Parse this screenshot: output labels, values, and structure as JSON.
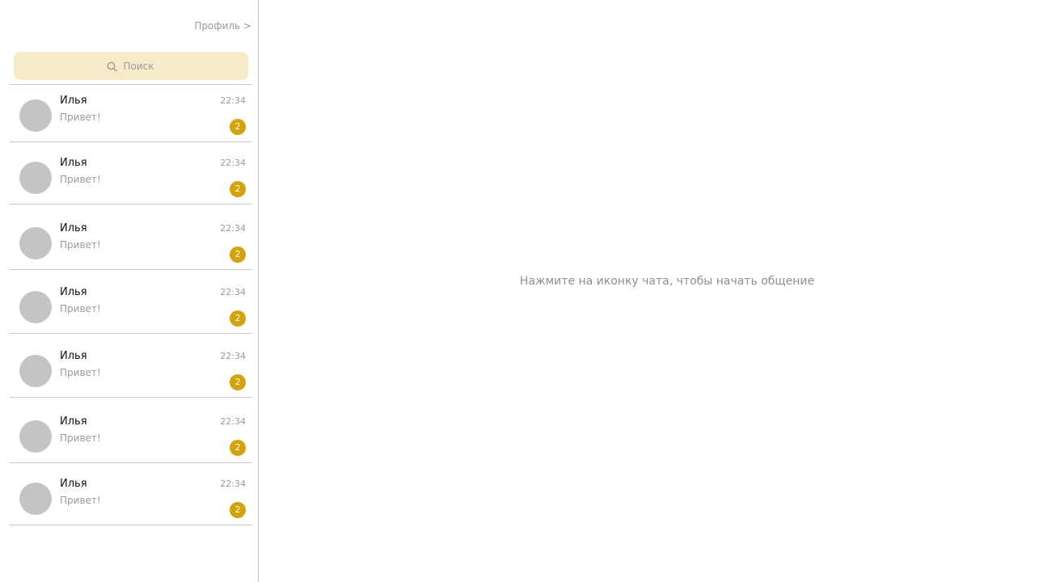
{
  "sidebar": {
    "profile_link": "Профиль >",
    "search": {
      "placeholder": "Поиск",
      "icon": "search-icon"
    },
    "chats": [
      {
        "name": "Илья",
        "preview": "Привет!",
        "time": "22:34",
        "unread": "2"
      },
      {
        "name": "Илья",
        "preview": "Привет!",
        "time": "22:34",
        "unread": "2"
      },
      {
        "name": "Илья",
        "preview": "Привет!",
        "time": "22:34",
        "unread": "2"
      },
      {
        "name": "Илья",
        "preview": "Привет!",
        "time": "22:34",
        "unread": "2"
      },
      {
        "name": "Илья",
        "preview": "Привет!",
        "time": "22:34",
        "unread": "2"
      },
      {
        "name": "Илья",
        "preview": "Привет!",
        "time": "22:34",
        "unread": "2"
      },
      {
        "name": "Илья",
        "preview": "Привет!",
        "time": "22:34",
        "unread": "2"
      }
    ]
  },
  "main": {
    "empty_hint": "Нажмите на иконку чата, чтобы начать общение"
  },
  "colors": {
    "search_background": "#f5ebc9",
    "badge_accent": "#d4a20a",
    "avatar_placeholder": "#c4c4c4",
    "divider": "#c8c8c8"
  }
}
